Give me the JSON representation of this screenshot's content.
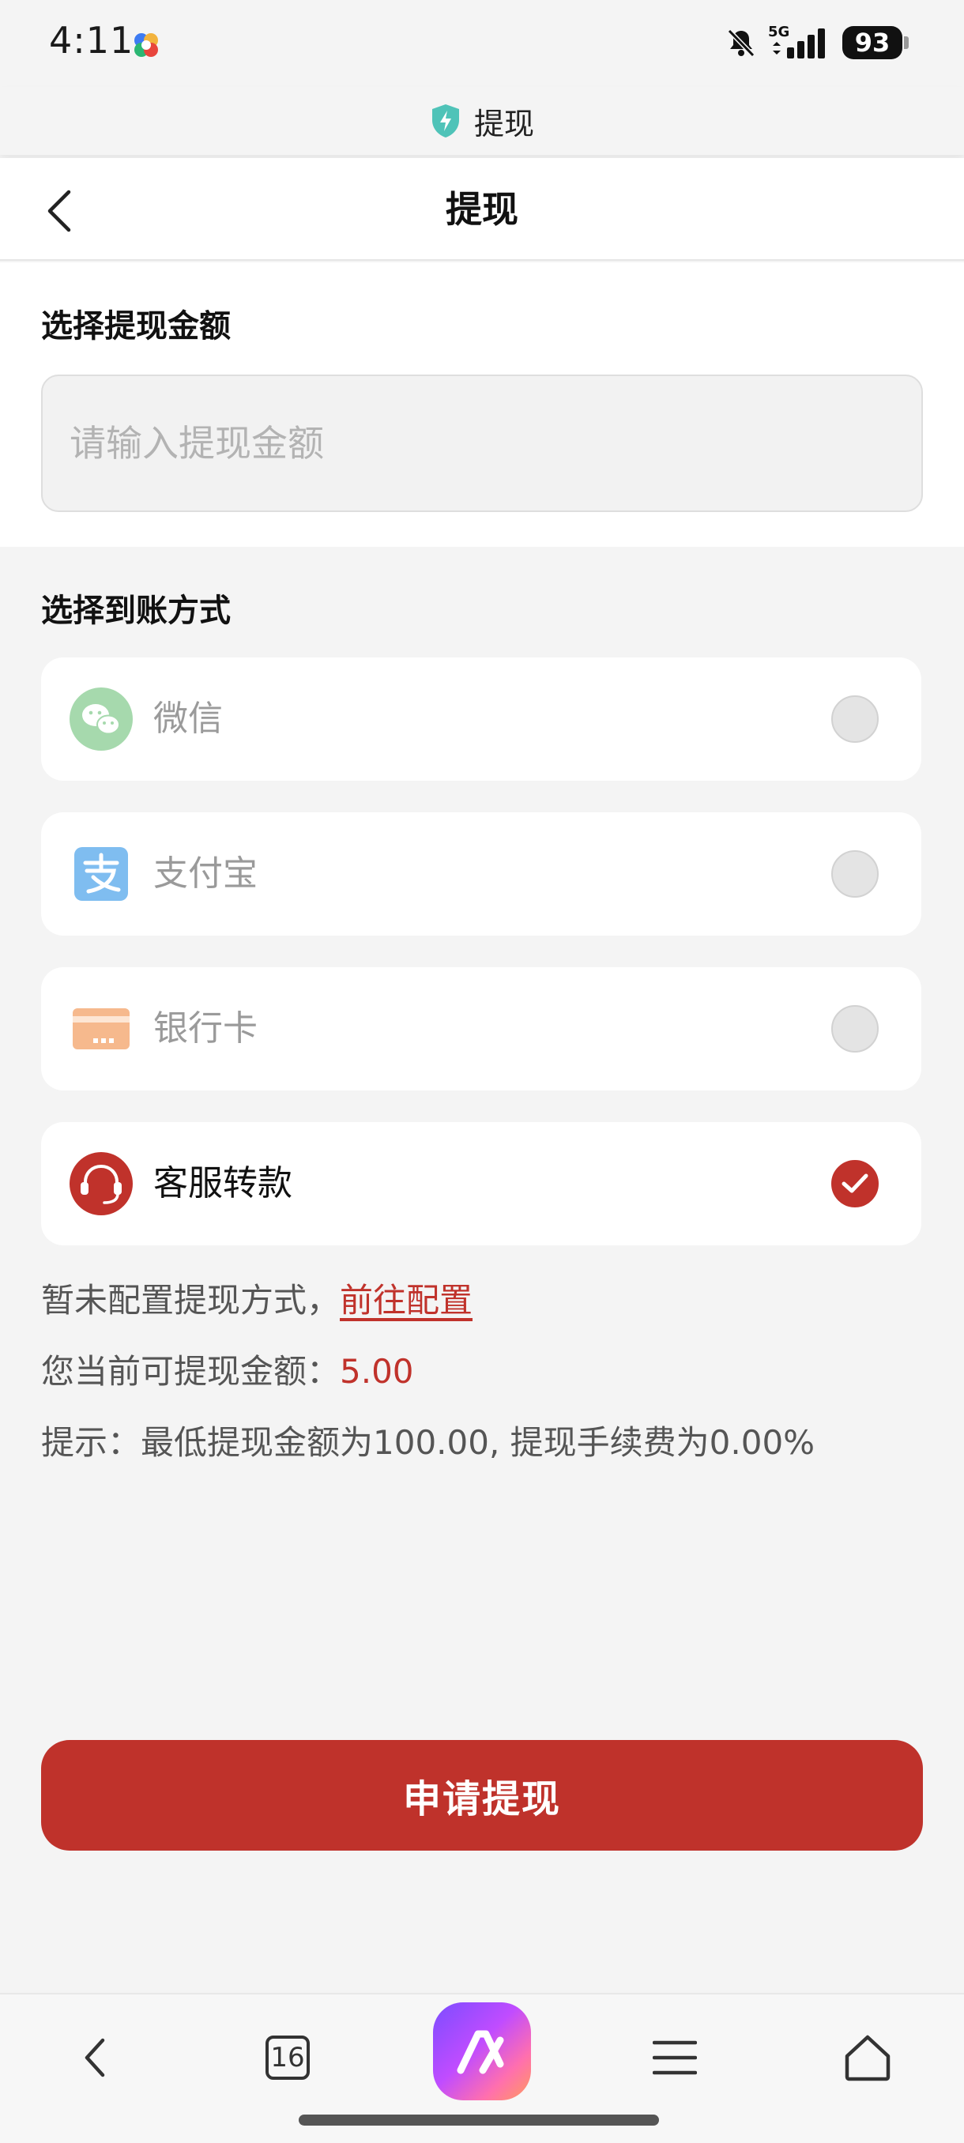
{
  "status_bar": {
    "time": "4:11",
    "network": "5G",
    "battery": "93"
  },
  "web_title": "提现",
  "nav": {
    "title": "提现"
  },
  "amount": {
    "section_title": "选择提现金额",
    "placeholder": "请输入提现金额",
    "value": ""
  },
  "methods": {
    "section_title": "选择到账方式",
    "items": [
      {
        "label": "微信",
        "icon": "wechat-icon",
        "color": "#a6d9ad",
        "state": "disabled",
        "selected": false
      },
      {
        "label": "支付宝",
        "icon": "alipay-icon",
        "color": "#7fbdf0",
        "state": "disabled",
        "selected": false
      },
      {
        "label": "银行卡",
        "icon": "bank-card-icon",
        "color": "#f6b98d",
        "state": "disabled",
        "selected": false
      },
      {
        "label": "客服转款",
        "icon": "customer-service-icon",
        "color": "#c0322b",
        "state": "enabled",
        "selected": true
      }
    ]
  },
  "info": {
    "not_configured_text": "暂未配置提现方式，",
    "config_link": "前往配置",
    "balance_label": "您当前可提现金额：",
    "balance_value": "5.00",
    "tip": "提示：最低提现金额为100.00, 提现手续费为0.00%"
  },
  "submit_label": "申请提现",
  "browser_bar": {
    "tab_count": "16"
  },
  "colors": {
    "accent": "#c0322b",
    "page_bg": "#f4f4f4",
    "card_bg": "#ffffff"
  }
}
